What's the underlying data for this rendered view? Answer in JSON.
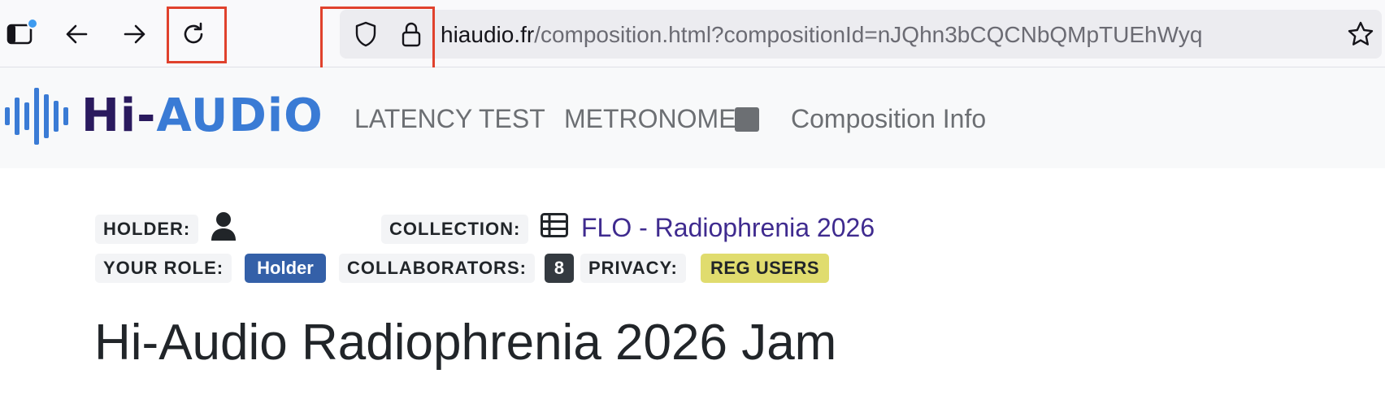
{
  "browser": {
    "url_domain": "hiaudio.fr",
    "url_path": "/composition.html?compositionId=nJQhn3bCQCNbQMpTUEhWyq"
  },
  "navbar": {
    "logo_hi": "Hi-",
    "logo_audio": "AUDiO",
    "latency_test": "LATENCY TEST",
    "metronome": "METRONOME",
    "composition_info": "Composition Info"
  },
  "meta": {
    "holder_label": "HOLDER:",
    "collection_label": "COLLECTION:",
    "collection_name": "FLO - Radiophrenia 2026",
    "role_label": "YOUR ROLE:",
    "role_value": "Holder",
    "collaborators_label": "COLLABORATORS:",
    "collaborators_count": "8",
    "privacy_label": "PRIVACY:",
    "privacy_value": "REG USERS"
  },
  "page": {
    "title": "Hi-Audio Radiophrenia 2026 Jam"
  },
  "icons": {
    "sidebar": "sidebar-icon",
    "back": "arrow-left-icon",
    "forward": "arrow-right-icon",
    "reload": "reload-icon",
    "shield": "shield-icon",
    "lock": "lock-icon",
    "bookmark": "star-icon",
    "holder": "user-icon",
    "collection": "table-list-icon"
  },
  "colors": {
    "highlight": "#e0412d",
    "brand_dark": "#2a1a5e",
    "brand_blue": "#3a7bd5",
    "role_badge": "#3460a8",
    "privacy_badge": "#e0dc6e",
    "link": "#3f2b8f"
  }
}
